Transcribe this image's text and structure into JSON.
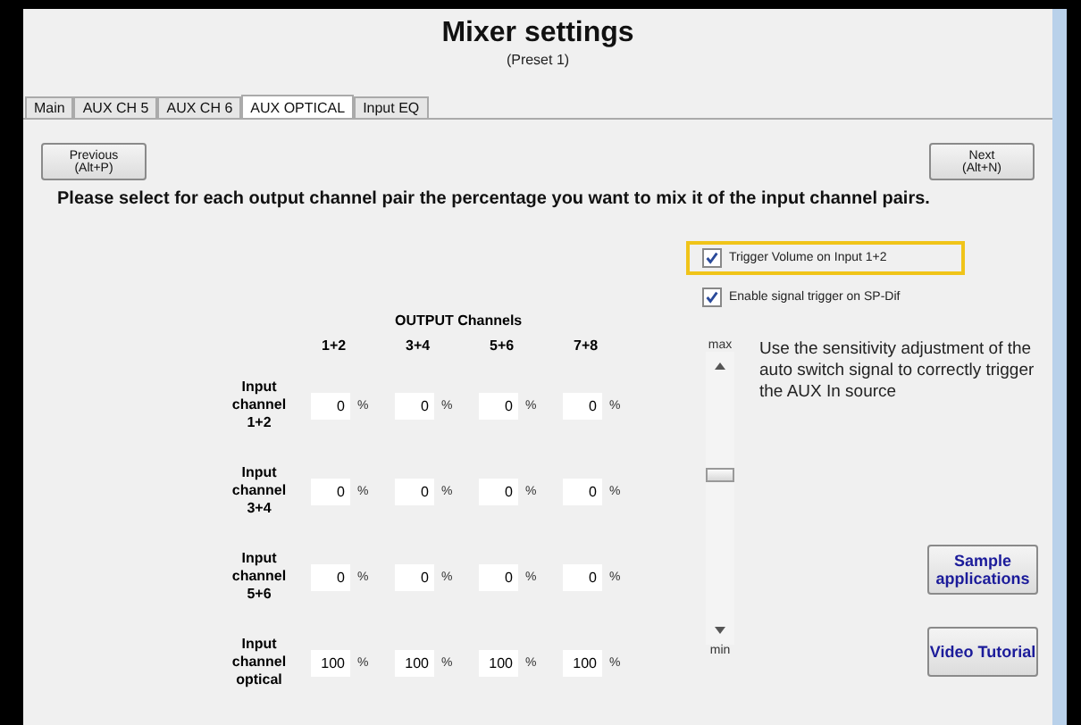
{
  "window": {
    "title": "Mixer settings",
    "subtitle": "(Preset 1)"
  },
  "tabs": [
    {
      "label": "Main",
      "selected": false
    },
    {
      "label": "AUX CH 5",
      "selected": false
    },
    {
      "label": "AUX CH 6",
      "selected": false
    },
    {
      "label": "AUX OPTICAL",
      "selected": true
    },
    {
      "label": "Input EQ",
      "selected": false
    }
  ],
  "nav": {
    "previous": "Previous\n(Alt+P)",
    "next": "Next\n(Alt+N)"
  },
  "instruction": "Please select for each output channel pair the percentage you want to mix it of the input channel pairs.",
  "matrix": {
    "title": "OUTPUT Channels",
    "unit": "%",
    "columns": [
      "1+2",
      "3+4",
      "5+6",
      "7+8"
    ],
    "rows": [
      {
        "label": "Input\nchannel\n1+2",
        "values": [
          "0",
          "0",
          "0",
          "0"
        ]
      },
      {
        "label": "Input\nchannel\n3+4",
        "values": [
          "0",
          "0",
          "0",
          "0"
        ]
      },
      {
        "label": "Input\nchannel\n5+6",
        "values": [
          "0",
          "0",
          "0",
          "0"
        ]
      },
      {
        "label": "Input\nchannel\noptical",
        "values": [
          "100",
          "100",
          "100",
          "100"
        ]
      }
    ]
  },
  "options": [
    {
      "label": "Trigger Volume on Input 1+2",
      "checked": true,
      "highlighted": true
    },
    {
      "label": "Enable signal trigger on SP-Dif",
      "checked": true,
      "highlighted": false
    }
  ],
  "sensitivity": {
    "max_label": "max",
    "min_label": "min",
    "level": 0.63,
    "description": "Use the sensitivity adjustment of the auto switch signal to correctly trigger the AUX In source"
  },
  "buttons": [
    "Sample applications",
    "Video Tutorial"
  ]
}
